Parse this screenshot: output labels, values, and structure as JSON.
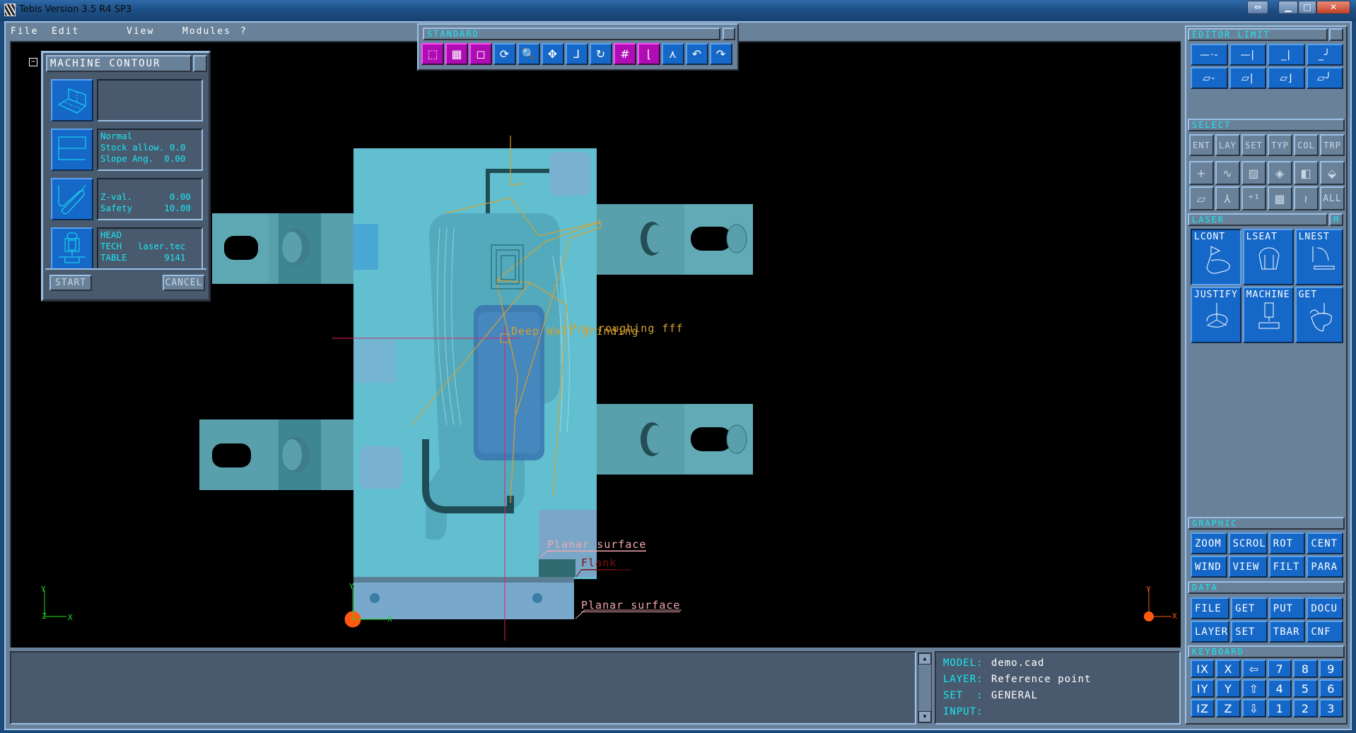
{
  "window": {
    "title": "Tebis Version 3.5 R4 SP3",
    "controls": {
      "swap": "⇔",
      "minimize": "▁",
      "maximize": "□",
      "close": "✕"
    }
  },
  "menu": [
    {
      "label": "File"
    },
    {
      "label": "Edit"
    },
    {
      "label": "View"
    },
    {
      "label": "Modules"
    },
    {
      "label": "?"
    }
  ],
  "toolbar": {
    "title": "STANDARD",
    "buttons": [
      {
        "icon": "wireframe-cube-icon",
        "glyph": "⬚",
        "active": true
      },
      {
        "icon": "shaded-cube-icon",
        "glyph": "▦",
        "active": true
      },
      {
        "icon": "hidden-line-cube-icon",
        "glyph": "◻",
        "active": true
      },
      {
        "icon": "rotate-icon",
        "glyph": "⟳",
        "active": false
      },
      {
        "icon": "zoom-icon",
        "glyph": "🔍",
        "active": false
      },
      {
        "icon": "pan-icon",
        "glyph": "✥",
        "active": false
      },
      {
        "icon": "axis-icon",
        "glyph": "⅃",
        "active": false
      },
      {
        "icon": "rotate-center-icon",
        "glyph": "↻",
        "active": false
      },
      {
        "icon": "grid-icon",
        "glyph": "#",
        "active": true
      },
      {
        "icon": "frame-axis-icon",
        "glyph": "⌊",
        "active": true
      },
      {
        "icon": "tripod-icon",
        "glyph": "⋏",
        "active": false
      },
      {
        "icon": "undo-icon",
        "glyph": "↶",
        "active": false
      },
      {
        "icon": "redo-icon",
        "glyph": "↷",
        "active": false
      }
    ]
  },
  "dialog": {
    "title": "MACHINE CONTOUR",
    "collapse": "−",
    "rows": [
      {
        "icon": "surface-select-icon",
        "text": ""
      },
      {
        "icon": "zigzag-strategy-icon",
        "text": "Normal\nStock allow. 0.0\nSlope Ang.  0.00"
      },
      {
        "icon": "approach-path-icon",
        "text": "\nZ-val.       0.00\nSafety      10.00"
      },
      {
        "icon": "machine-head-icon",
        "text": "HEAD\nTECH   laser.tec\nTABLE       9141"
      }
    ],
    "start_label": "START",
    "cancel_label": "CANCEL"
  },
  "viewport": {
    "annotations": {
      "op1": "Deep Wall grinding",
      "op2": "Pre-roughing fff",
      "planar1": "Planar surface",
      "flank": "Flank",
      "planar2": "Planar surface"
    },
    "axes": {
      "x": "X",
      "y": "Y",
      "z": "Z"
    },
    "colors": {
      "part": "#62bfcf",
      "toolpath": "#d8a030",
      "crosshair": "#e0206a",
      "axis_green": "#20e020",
      "axis_orange": "#ff5a10"
    }
  },
  "status": {
    "rows": [
      {
        "key": "MODEL:",
        "value": "demo.cad"
      },
      {
        "key": "LAYER:",
        "value": "Reference point"
      },
      {
        "key": "SET  :",
        "value": "GENERAL"
      },
      {
        "key": "INPUT:",
        "value": ""
      }
    ],
    "scroll_up": "▲",
    "scroll_down": "▼"
  },
  "rpanel": {
    "editor": {
      "title": "EDITOR  LIMIT",
      "buttons": [
        {
          "icon": "limit-line-dash-icon"
        },
        {
          "icon": "limit-line-end-icon"
        },
        {
          "icon": "limit-line-corner-icon"
        },
        {
          "icon": "limit-line-round-icon"
        },
        {
          "icon": "limit-surface-dash-icon"
        },
        {
          "icon": "limit-surface-end-icon"
        },
        {
          "icon": "limit-surface-corner-icon"
        },
        {
          "icon": "limit-surface-round-icon"
        }
      ]
    },
    "select": {
      "title": "SELECT",
      "filters": [
        "ENT",
        "LAY",
        "SET",
        "TYP",
        "COL",
        "TRP"
      ],
      "types": [
        {
          "icon": "point-icon",
          "glyph": "+"
        },
        {
          "icon": "curve-icon",
          "glyph": "∿"
        },
        {
          "icon": "surface-patch-icon",
          "glyph": "▨"
        },
        {
          "icon": "trimmed-surface-icon",
          "glyph": "◈"
        },
        {
          "icon": "face-icon",
          "glyph": "◧"
        },
        {
          "icon": "solid-icon",
          "glyph": "⬙"
        },
        {
          "icon": "plane-icon",
          "glyph": "▱"
        },
        {
          "icon": "coordinate-system-icon",
          "glyph": "⅄"
        },
        {
          "icon": "numbered-point-icon",
          "glyph": "⁺¹"
        },
        {
          "icon": "mesh-icon",
          "glyph": "▩"
        },
        {
          "icon": "curves-bundle-icon",
          "glyph": "≀"
        },
        {
          "label": "ALL"
        }
      ]
    },
    "laser": {
      "title": "LASER",
      "mode": "M",
      "buttons": [
        {
          "label": "LCONT",
          "icon": "laser-contour-icon"
        },
        {
          "label": "LSEAT",
          "icon": "laser-seat-icon"
        },
        {
          "label": "LNEST",
          "icon": "laser-nest-icon"
        },
        {
          "label": "JUSTIFY",
          "icon": "justify-icon"
        },
        {
          "label": "MACHINE",
          "icon": "machine-icon"
        },
        {
          "label": "GET",
          "icon": "get-icon"
        }
      ]
    },
    "graphic": {
      "title": "GRAPHIC",
      "buttons": [
        "ZOOM",
        "SCROL",
        "ROT",
        "CENT",
        "WIND",
        "VIEW",
        "FILT",
        "PARA"
      ]
    },
    "data": {
      "title": "DATA",
      "buttons": [
        "FILE",
        "GET",
        "PUT",
        "DOCU",
        "LAYER",
        "SET",
        "TBAR",
        "CNF"
      ]
    },
    "keyboard": {
      "title": "KEYBOARD",
      "keys": [
        "IX",
        "X",
        "⇦",
        "7",
        "8",
        "9",
        "IY",
        "Y",
        "⇧",
        "4",
        "5",
        "6",
        "IZ",
        "Z",
        "⇩",
        "1",
        "2",
        "3"
      ]
    }
  }
}
